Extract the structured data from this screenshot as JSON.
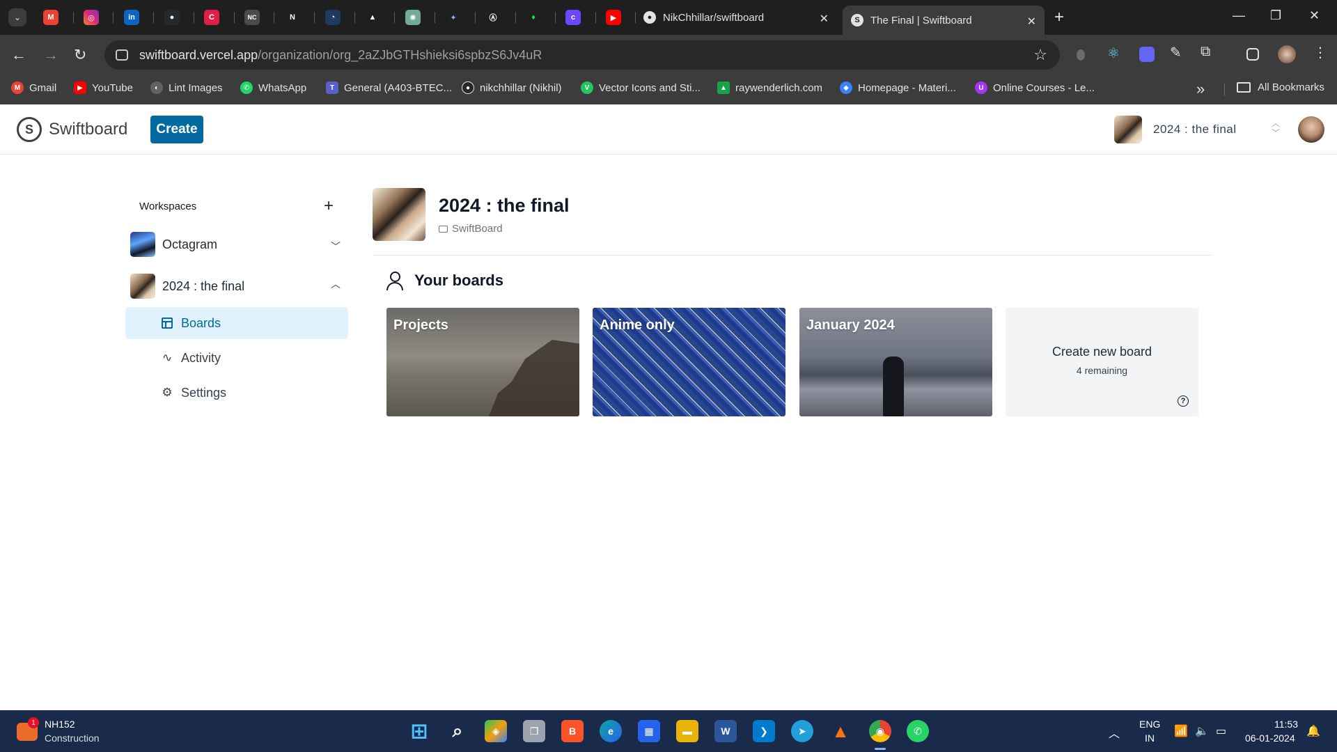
{
  "browser": {
    "tabs": [
      {
        "title": "NikChhillar/swiftboard",
        "favicon": "github-icon"
      },
      {
        "title": "The Final | Swiftboard",
        "favicon": "swiftboard-icon",
        "active": true
      }
    ],
    "pinned_tab_icons": [
      "gmail-icon",
      "instagram-icon",
      "linkedin-icon",
      "github-icon",
      "c-icon",
      "nc-icon",
      "notion-icon",
      "chat-icon",
      "vercel-icon",
      "chatgpt-icon",
      "gemini-icon",
      "arc-icon",
      "mongodb-icon",
      "clerk-icon",
      "youtube-icon"
    ],
    "pinned_badges": {
      "linkedin": "in",
      "c": "C",
      "nc": "NC",
      "notion": "N"
    },
    "address": {
      "host": "swiftboard.vercel.app",
      "path": "/organization/org_2aZJbGTHshieksi6spbzS6Jv4uR"
    },
    "bookmarks": [
      {
        "label": "Gmail",
        "icon": "gmail-icon",
        "color": "#ea4335",
        "badge": "M"
      },
      {
        "label": "YouTube",
        "icon": "youtube-icon",
        "color": "#ff0000",
        "badge": "▶"
      },
      {
        "label": "Lint Images",
        "icon": "globe-icon",
        "color": "#5f6368",
        "badge": "◐"
      },
      {
        "label": "WhatsApp",
        "icon": "whatsapp-icon",
        "color": "#25d366",
        "badge": "✆"
      },
      {
        "label": "General (A403-BTEC...",
        "icon": "teams-icon",
        "color": "#5b5fc7",
        "badge": "T"
      },
      {
        "label": "nikchhillar (Nikhil)",
        "icon": "github-icon",
        "color": "#24292f",
        "badge": "●"
      },
      {
        "label": "Vector Icons and Sti...",
        "icon": "vector-icon",
        "color": "#22c55e",
        "badge": "V"
      },
      {
        "label": "raywenderlich.com",
        "icon": "raywenderlich-icon",
        "color": "#16a34a",
        "badge": "▲"
      },
      {
        "label": "Homepage - Materi...",
        "icon": "material-icon",
        "color": "#3b82f6",
        "badge": "◆"
      },
      {
        "label": "Online Courses - Le...",
        "icon": "udemy-icon",
        "color": "#a435f0",
        "badge": "U"
      }
    ],
    "all_bookmarks": "All Bookmarks"
  },
  "app": {
    "logo_text": "Swiftboard",
    "logo_letter": "S",
    "create_label": "Create",
    "org_switcher_name": "2024 : the final"
  },
  "sidebar": {
    "title": "Workspaces",
    "add_symbol": "+",
    "workspaces": [
      {
        "name": "Octagram",
        "expanded": false
      },
      {
        "name": "2024 : the final",
        "expanded": true
      }
    ],
    "items": [
      {
        "label": "Boards",
        "icon": "board-icon",
        "active": true
      },
      {
        "label": "Activity",
        "icon": "activity-icon"
      },
      {
        "label": "Settings",
        "icon": "settings-icon"
      }
    ]
  },
  "main": {
    "org_title": "2024 : the final",
    "org_subtitle": "SwiftBoard",
    "section_title": "Your boards",
    "boards": [
      {
        "title": "Projects"
      },
      {
        "title": "Anime only"
      },
      {
        "title": "January 2024"
      }
    ],
    "new_board": {
      "title": "Create new board",
      "remaining": "4 remaining"
    }
  },
  "taskbar": {
    "weather_title": "NH152",
    "weather_sub": "Construction",
    "notification_count": "1",
    "lang_line1": "ENG",
    "lang_line2": "IN",
    "time": "11:53",
    "date": "06-01-2024",
    "apps": [
      {
        "name": "windows-start-icon",
        "color": "#0ea5e9",
        "badge": "⊞"
      },
      {
        "name": "search-icon",
        "color": "#1a2a4a",
        "badge": "⌕"
      },
      {
        "name": "copilot-icon",
        "color": "#f59e0b",
        "badge": "◈"
      },
      {
        "name": "task-view-icon",
        "color": "#6b7280",
        "badge": "❐"
      },
      {
        "name": "brave-icon",
        "color": "#fb542b",
        "badge": "B"
      },
      {
        "name": "edge-icon",
        "color": "#0ea5a4",
        "badge": "e"
      },
      {
        "name": "store-icon",
        "color": "#2563eb",
        "badge": "▦"
      },
      {
        "name": "file-explorer-icon",
        "color": "#eab308",
        "badge": "▬"
      },
      {
        "name": "word-icon",
        "color": "#2b579a",
        "badge": "W"
      },
      {
        "name": "vscode-icon",
        "color": "#007acc",
        "badge": "❯"
      },
      {
        "name": "telegram-icon",
        "color": "#229ed9",
        "badge": "➤"
      },
      {
        "name": "vlc-icon",
        "color": "#f97316",
        "badge": "▲"
      },
      {
        "name": "chrome-icon",
        "color": "#4285f4",
        "badge": "◉"
      },
      {
        "name": "whatsapp-icon",
        "color": "#25d366",
        "badge": "✆"
      }
    ]
  }
}
